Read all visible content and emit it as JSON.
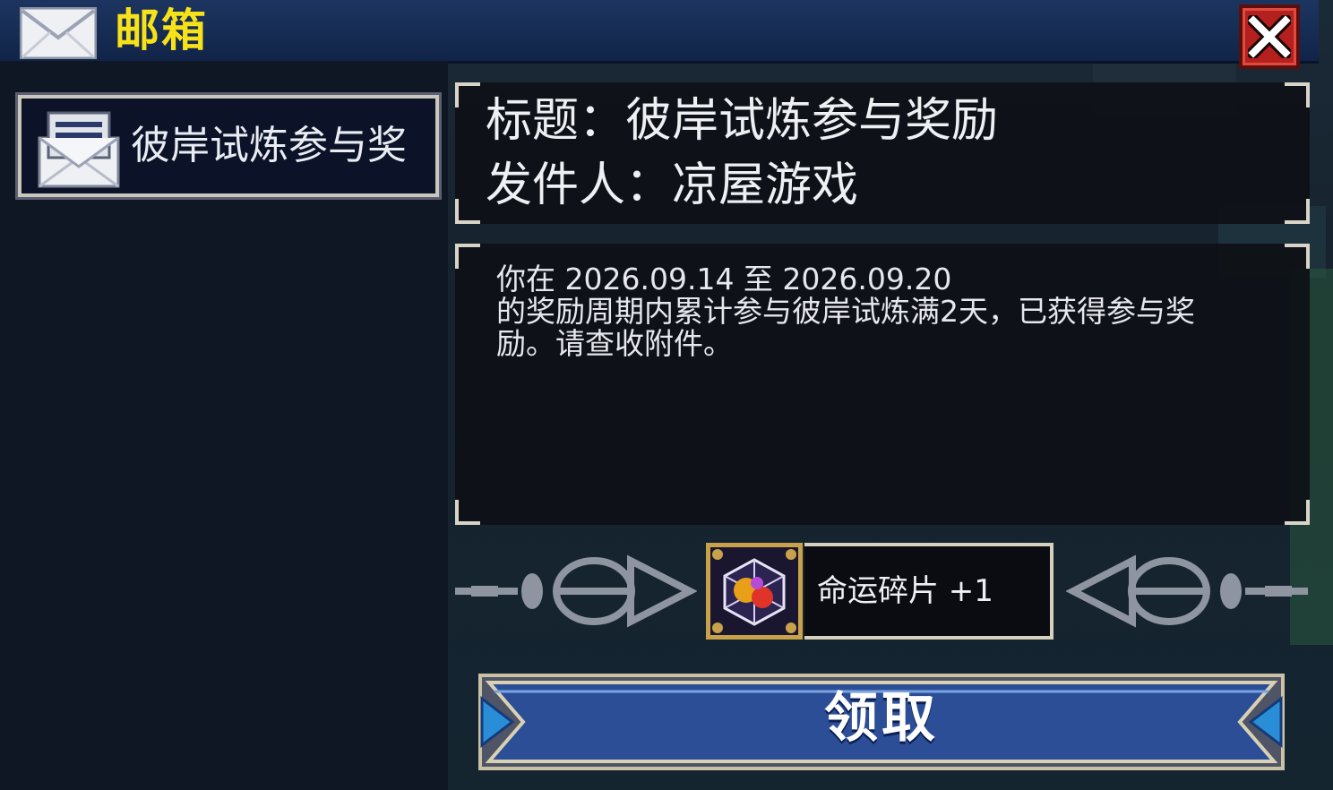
{
  "window": {
    "title": "邮箱",
    "close_icon": "close-x-icon",
    "accent_color": "#f7e21a"
  },
  "mail_list": {
    "items": [
      {
        "label": "彼岸试炼参与奖",
        "icon": "opened-letter-icon",
        "selected": true
      }
    ]
  },
  "mail_detail": {
    "subject_line": "标题：彼岸试炼参与奖励",
    "sender_line": "发件人：凉屋游戏",
    "body_lines": [
      "你在 2026.09.14 至 2026.09.20",
      "的奖励周期内累计参与彼岸试炼满2天，已获得参与奖",
      "励。请查收附件。"
    ]
  },
  "attachment": {
    "icon": "fate-shard-cube-icon",
    "label": "命运碎片 +1"
  },
  "actions": {
    "claim_label": "领取",
    "claim_color": "#2c4e97"
  }
}
